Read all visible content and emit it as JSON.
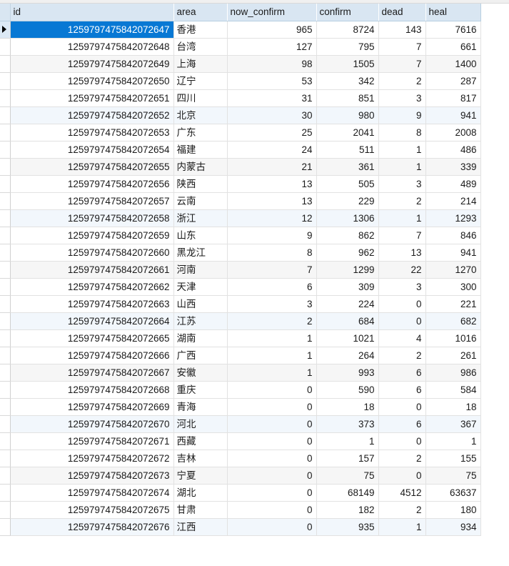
{
  "grid": {
    "row_marker_icon": "play-triangle-icon",
    "selected_row_index": 0,
    "selection_color": "#0878d4",
    "header_background": "#d9e6f2",
    "stripe_gray": "#f6f6f6",
    "stripe_blue": "#f2f7fc",
    "columns": [
      {
        "key": "id",
        "label": "id",
        "align": "right"
      },
      {
        "key": "area",
        "label": "area",
        "align": "left"
      },
      {
        "key": "now_confirm",
        "label": "now_confirm",
        "align": "right"
      },
      {
        "key": "confirm",
        "label": "confirm",
        "align": "right"
      },
      {
        "key": "dead",
        "label": "dead",
        "align": "right"
      },
      {
        "key": "heal",
        "label": "heal",
        "align": "right"
      }
    ],
    "rows": [
      {
        "id": "1259797475842072647",
        "area": "香港",
        "now_confirm": "965",
        "confirm": "8724",
        "dead": "143",
        "heal": "7616"
      },
      {
        "id": "1259797475842072648",
        "area": "台湾",
        "now_confirm": "127",
        "confirm": "795",
        "dead": "7",
        "heal": "661"
      },
      {
        "id": "1259797475842072649",
        "area": "上海",
        "now_confirm": "98",
        "confirm": "1505",
        "dead": "7",
        "heal": "1400"
      },
      {
        "id": "1259797475842072650",
        "area": "辽宁",
        "now_confirm": "53",
        "confirm": "342",
        "dead": "2",
        "heal": "287"
      },
      {
        "id": "1259797475842072651",
        "area": "四川",
        "now_confirm": "31",
        "confirm": "851",
        "dead": "3",
        "heal": "817"
      },
      {
        "id": "1259797475842072652",
        "area": "北京",
        "now_confirm": "30",
        "confirm": "980",
        "dead": "9",
        "heal": "941"
      },
      {
        "id": "1259797475842072653",
        "area": "广东",
        "now_confirm": "25",
        "confirm": "2041",
        "dead": "8",
        "heal": "2008"
      },
      {
        "id": "1259797475842072654",
        "area": "福建",
        "now_confirm": "24",
        "confirm": "511",
        "dead": "1",
        "heal": "486"
      },
      {
        "id": "1259797475842072655",
        "area": "内蒙古",
        "now_confirm": "21",
        "confirm": "361",
        "dead": "1",
        "heal": "339"
      },
      {
        "id": "1259797475842072656",
        "area": "陕西",
        "now_confirm": "13",
        "confirm": "505",
        "dead": "3",
        "heal": "489"
      },
      {
        "id": "1259797475842072657",
        "area": "云南",
        "now_confirm": "13",
        "confirm": "229",
        "dead": "2",
        "heal": "214"
      },
      {
        "id": "1259797475842072658",
        "area": "浙江",
        "now_confirm": "12",
        "confirm": "1306",
        "dead": "1",
        "heal": "1293"
      },
      {
        "id": "1259797475842072659",
        "area": "山东",
        "now_confirm": "9",
        "confirm": "862",
        "dead": "7",
        "heal": "846"
      },
      {
        "id": "1259797475842072660",
        "area": "黑龙江",
        "now_confirm": "8",
        "confirm": "962",
        "dead": "13",
        "heal": "941"
      },
      {
        "id": "1259797475842072661",
        "area": "河南",
        "now_confirm": "7",
        "confirm": "1299",
        "dead": "22",
        "heal": "1270"
      },
      {
        "id": "1259797475842072662",
        "area": "天津",
        "now_confirm": "6",
        "confirm": "309",
        "dead": "3",
        "heal": "300"
      },
      {
        "id": "1259797475842072663",
        "area": "山西",
        "now_confirm": "3",
        "confirm": "224",
        "dead": "0",
        "heal": "221"
      },
      {
        "id": "1259797475842072664",
        "area": "江苏",
        "now_confirm": "2",
        "confirm": "684",
        "dead": "0",
        "heal": "682"
      },
      {
        "id": "1259797475842072665",
        "area": "湖南",
        "now_confirm": "1",
        "confirm": "1021",
        "dead": "4",
        "heal": "1016"
      },
      {
        "id": "1259797475842072666",
        "area": "广西",
        "now_confirm": "1",
        "confirm": "264",
        "dead": "2",
        "heal": "261"
      },
      {
        "id": "1259797475842072667",
        "area": "安徽",
        "now_confirm": "1",
        "confirm": "993",
        "dead": "6",
        "heal": "986"
      },
      {
        "id": "1259797475842072668",
        "area": "重庆",
        "now_confirm": "0",
        "confirm": "590",
        "dead": "6",
        "heal": "584"
      },
      {
        "id": "1259797475842072669",
        "area": "青海",
        "now_confirm": "0",
        "confirm": "18",
        "dead": "0",
        "heal": "18"
      },
      {
        "id": "1259797475842072670",
        "area": "河北",
        "now_confirm": "0",
        "confirm": "373",
        "dead": "6",
        "heal": "367"
      },
      {
        "id": "1259797475842072671",
        "area": "西藏",
        "now_confirm": "0",
        "confirm": "1",
        "dead": "0",
        "heal": "1"
      },
      {
        "id": "1259797475842072672",
        "area": "吉林",
        "now_confirm": "0",
        "confirm": "157",
        "dead": "2",
        "heal": "155"
      },
      {
        "id": "1259797475842072673",
        "area": "宁夏",
        "now_confirm": "0",
        "confirm": "75",
        "dead": "0",
        "heal": "75"
      },
      {
        "id": "1259797475842072674",
        "area": "湖北",
        "now_confirm": "0",
        "confirm": "68149",
        "dead": "4512",
        "heal": "63637"
      },
      {
        "id": "1259797475842072675",
        "area": "甘肃",
        "now_confirm": "0",
        "confirm": "182",
        "dead": "2",
        "heal": "180"
      },
      {
        "id": "1259797475842072676",
        "area": "江西",
        "now_confirm": "0",
        "confirm": "935",
        "dead": "1",
        "heal": "934"
      }
    ]
  }
}
